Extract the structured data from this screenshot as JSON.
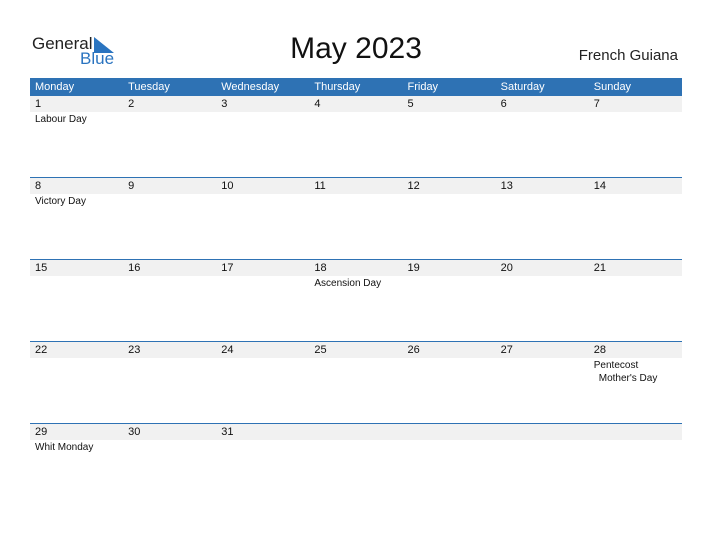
{
  "logo": {
    "word1": "General",
    "word2": "Blue"
  },
  "title": "May 2023",
  "country": "French Guiana",
  "weekdays": [
    "Monday",
    "Tuesday",
    "Wednesday",
    "Thursday",
    "Friday",
    "Saturday",
    "Sunday"
  ],
  "weeks": [
    {
      "days": [
        "1",
        "2",
        "3",
        "4",
        "5",
        "6",
        "7"
      ],
      "events": [
        [
          "Labour Day"
        ],
        [],
        [],
        [],
        [],
        [],
        []
      ]
    },
    {
      "days": [
        "8",
        "9",
        "10",
        "11",
        "12",
        "13",
        "14"
      ],
      "events": [
        [
          "Victory Day"
        ],
        [],
        [],
        [],
        [],
        [],
        []
      ]
    },
    {
      "days": [
        "15",
        "16",
        "17",
        "18",
        "19",
        "20",
        "21"
      ],
      "events": [
        [],
        [],
        [],
        [
          "Ascension Day"
        ],
        [],
        [],
        []
      ]
    },
    {
      "days": [
        "22",
        "23",
        "24",
        "25",
        "26",
        "27",
        "28"
      ],
      "events": [
        [],
        [],
        [],
        [],
        [],
        [],
        [
          "Pentecost",
          "Mother's Day"
        ]
      ]
    },
    {
      "days": [
        "29",
        "30",
        "31",
        "",
        "",
        "",
        ""
      ],
      "events": [
        [
          "Whit Monday"
        ],
        [],
        [],
        [],
        [],
        [],
        []
      ]
    }
  ],
  "colors": {
    "accent": "#2e72b4",
    "logo_blue": "#2a74c0",
    "strip": "#f1f1f1"
  }
}
